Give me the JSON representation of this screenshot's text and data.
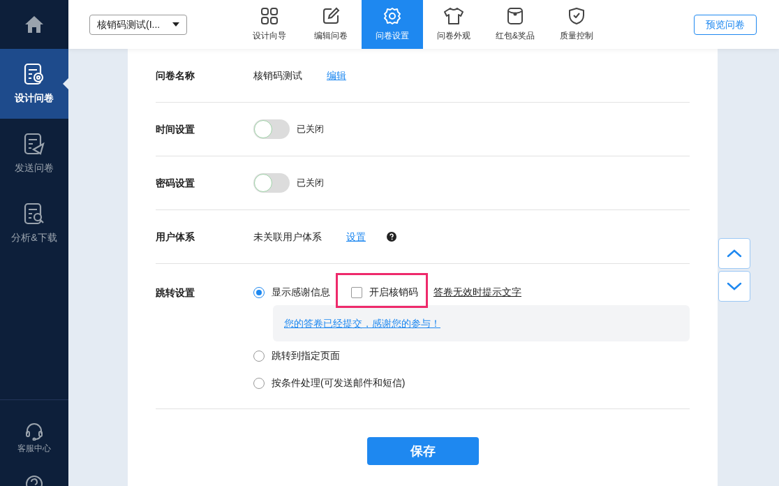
{
  "sidebar": {
    "items": [
      {
        "selected": false
      },
      {
        "label": "设计问卷",
        "selected": true
      },
      {
        "label": "发送问卷",
        "selected": false
      },
      {
        "label": "分析&下载",
        "selected": false
      }
    ],
    "bottom_items": [
      {
        "label": "客服中心"
      }
    ]
  },
  "survey_select": {
    "value": "核销码测试(I..."
  },
  "tabs": [
    {
      "label": "设计向导",
      "selected": false
    },
    {
      "label": "编辑问卷",
      "selected": false
    },
    {
      "label": "问卷设置",
      "selected": true
    },
    {
      "label": "问卷外观",
      "selected": false
    },
    {
      "label": "红包&奖品",
      "selected": false
    },
    {
      "label": "质量控制",
      "selected": false
    }
  ],
  "preview_button": "预览问卷",
  "settings": [
    {
      "kind": "text",
      "label": "问卷名称",
      "value": "核销码测试",
      "link": "编辑"
    },
    {
      "kind": "toggle",
      "label": "时间设置",
      "on": false,
      "status": "已关闭"
    },
    {
      "kind": "toggle",
      "label": "密码设置",
      "on": false,
      "status": "已关闭"
    },
    {
      "kind": "text",
      "label": "用户体系",
      "value": "未关联用户体系",
      "link": "设置",
      "help": true
    },
    {
      "kind": "radio",
      "label": "跳转设置",
      "options": [
        {
          "label": "显示感谢信息",
          "selected": true,
          "checkbox": {
            "label": "开启核销码",
            "checked": false
          },
          "extra_link": "答卷无效时提示文字",
          "message": "您的答卷已经提交，感谢您的参与！"
        },
        {
          "label": "跳转到指定页面",
          "selected": false
        },
        {
          "label": "按条件处理(可发送邮件和短信)",
          "selected": false
        }
      ]
    }
  ],
  "save_button": "保存"
}
